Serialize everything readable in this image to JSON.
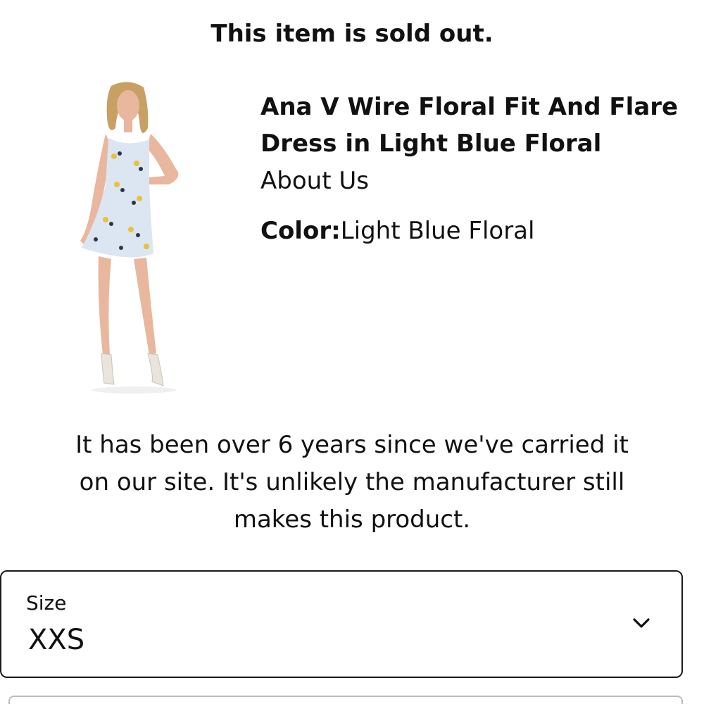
{
  "notice": {
    "text": "This item is sold out."
  },
  "product": {
    "title": "Ana V Wire Floral Fit And Flare Dress in Light Blue Floral",
    "title_lines": [
      "Ana V Wire Floral Fit And Flare",
      "Dress in Light Blue Floral"
    ],
    "brand": "About Us",
    "color_label": "Color:",
    "color_value": "Light Blue Floral",
    "image_icon": "product-photo-dress"
  },
  "message": {
    "lines": [
      "It has been over 6 years since we've carried it",
      "on our site. It's unlikely the manufacturer still",
      "makes this product."
    ]
  },
  "size_selector": {
    "label": "Size",
    "selected": "XXS",
    "icon": "chevron-down-icon"
  },
  "colors": {
    "dress": "#dce6f2",
    "floral_yellow": "#e8c23a",
    "floral_navy": "#2a3550",
    "skin": "#e8b79e",
    "hair": "#c8a064",
    "border": "#1a1a1a"
  }
}
